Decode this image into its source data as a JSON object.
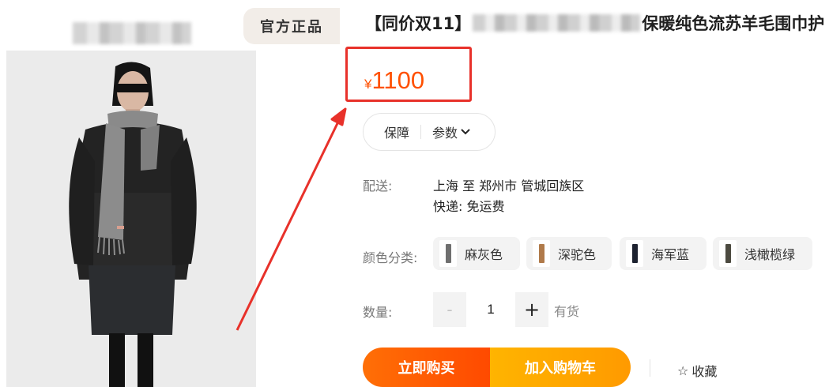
{
  "badge": {
    "official": "官方正品"
  },
  "product": {
    "title_prefix": "【同价双11】",
    "title_suffix": "保暖纯色流苏羊毛围巾护"
  },
  "price": {
    "currency": "¥",
    "amount": "1100"
  },
  "service": {
    "guarantee": "保障",
    "params": "参数"
  },
  "shipping": {
    "label": "配送:",
    "route": "上海 至 郑州市 管城回族区",
    "express": "快递: 免运费"
  },
  "colors": {
    "label": "颜色分类:",
    "options": [
      {
        "name": "麻灰色",
        "swatch": "#6f6f6f"
      },
      {
        "name": "深驼色",
        "swatch": "#b07a4a"
      },
      {
        "name": "海军蓝",
        "swatch": "#1d2230"
      },
      {
        "name": "浅橄榄绿",
        "swatch": "#4c4a40"
      }
    ]
  },
  "quantity": {
    "label": "数量:",
    "minus": "-",
    "value": "1",
    "plus": "+",
    "stock": "有货"
  },
  "actions": {
    "buy_now": "立即购买",
    "add_cart": "加入购物车",
    "favorite": "收藏",
    "favorite_icon": "☆"
  },
  "theme": {
    "price_color": "#ff5000",
    "highlight_red": "#e8312a",
    "buy_orange": "#ff5000",
    "cart_yellow": "#ffa800"
  }
}
